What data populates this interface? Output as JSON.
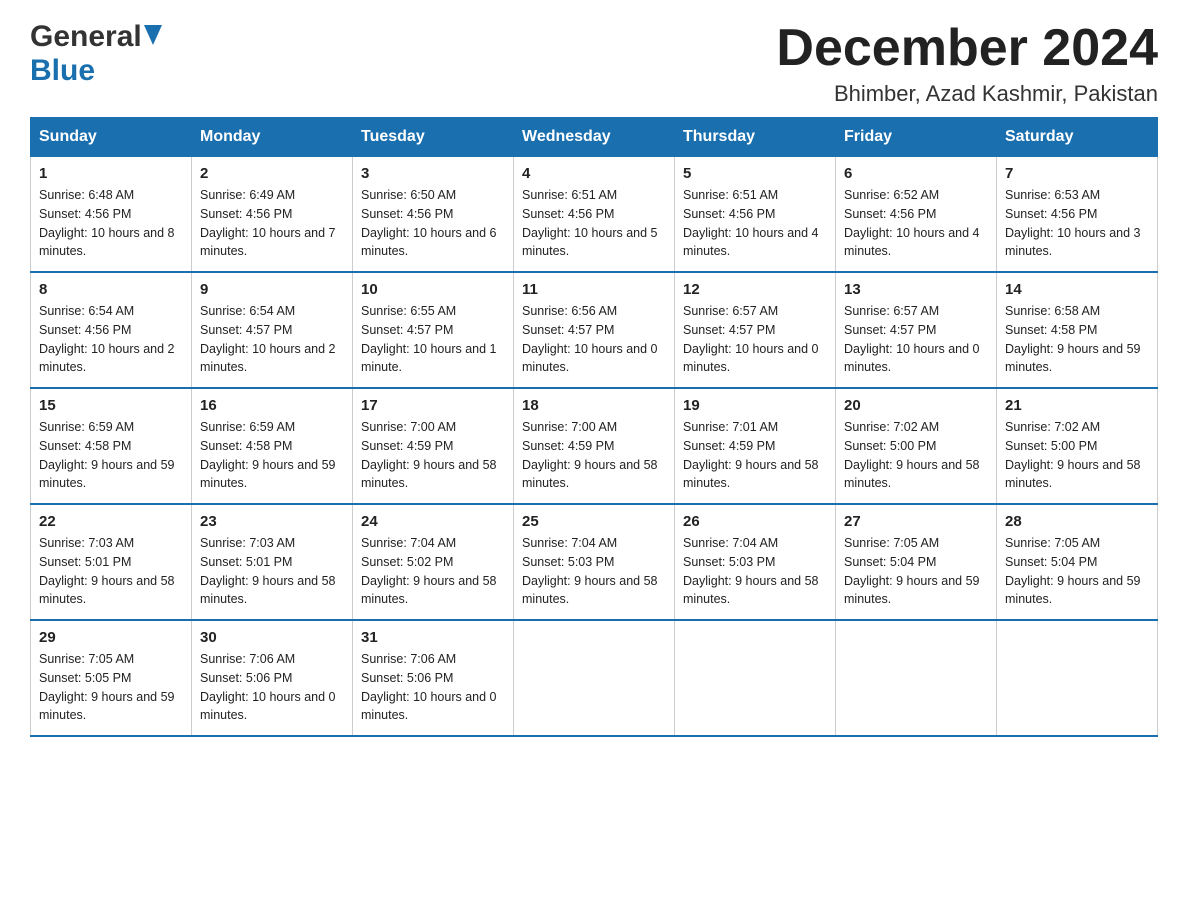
{
  "header": {
    "logo_general": "General",
    "logo_blue": "Blue",
    "month_title": "December 2024",
    "location": "Bhimber, Azad Kashmir, Pakistan"
  },
  "calendar": {
    "days": [
      "Sunday",
      "Monday",
      "Tuesday",
      "Wednesday",
      "Thursday",
      "Friday",
      "Saturday"
    ],
    "weeks": [
      [
        {
          "day": "1",
          "sunrise": "6:48 AM",
          "sunset": "4:56 PM",
          "daylight": "10 hours and 8 minutes."
        },
        {
          "day": "2",
          "sunrise": "6:49 AM",
          "sunset": "4:56 PM",
          "daylight": "10 hours and 7 minutes."
        },
        {
          "day": "3",
          "sunrise": "6:50 AM",
          "sunset": "4:56 PM",
          "daylight": "10 hours and 6 minutes."
        },
        {
          "day": "4",
          "sunrise": "6:51 AM",
          "sunset": "4:56 PM",
          "daylight": "10 hours and 5 minutes."
        },
        {
          "day": "5",
          "sunrise": "6:51 AM",
          "sunset": "4:56 PM",
          "daylight": "10 hours and 4 minutes."
        },
        {
          "day": "6",
          "sunrise": "6:52 AM",
          "sunset": "4:56 PM",
          "daylight": "10 hours and 4 minutes."
        },
        {
          "day": "7",
          "sunrise": "6:53 AM",
          "sunset": "4:56 PM",
          "daylight": "10 hours and 3 minutes."
        }
      ],
      [
        {
          "day": "8",
          "sunrise": "6:54 AM",
          "sunset": "4:56 PM",
          "daylight": "10 hours and 2 minutes."
        },
        {
          "day": "9",
          "sunrise": "6:54 AM",
          "sunset": "4:57 PM",
          "daylight": "10 hours and 2 minutes."
        },
        {
          "day": "10",
          "sunrise": "6:55 AM",
          "sunset": "4:57 PM",
          "daylight": "10 hours and 1 minute."
        },
        {
          "day": "11",
          "sunrise": "6:56 AM",
          "sunset": "4:57 PM",
          "daylight": "10 hours and 0 minutes."
        },
        {
          "day": "12",
          "sunrise": "6:57 AM",
          "sunset": "4:57 PM",
          "daylight": "10 hours and 0 minutes."
        },
        {
          "day": "13",
          "sunrise": "6:57 AM",
          "sunset": "4:57 PM",
          "daylight": "10 hours and 0 minutes."
        },
        {
          "day": "14",
          "sunrise": "6:58 AM",
          "sunset": "4:58 PM",
          "daylight": "9 hours and 59 minutes."
        }
      ],
      [
        {
          "day": "15",
          "sunrise": "6:59 AM",
          "sunset": "4:58 PM",
          "daylight": "9 hours and 59 minutes."
        },
        {
          "day": "16",
          "sunrise": "6:59 AM",
          "sunset": "4:58 PM",
          "daylight": "9 hours and 59 minutes."
        },
        {
          "day": "17",
          "sunrise": "7:00 AM",
          "sunset": "4:59 PM",
          "daylight": "9 hours and 58 minutes."
        },
        {
          "day": "18",
          "sunrise": "7:00 AM",
          "sunset": "4:59 PM",
          "daylight": "9 hours and 58 minutes."
        },
        {
          "day": "19",
          "sunrise": "7:01 AM",
          "sunset": "4:59 PM",
          "daylight": "9 hours and 58 minutes."
        },
        {
          "day": "20",
          "sunrise": "7:02 AM",
          "sunset": "5:00 PM",
          "daylight": "9 hours and 58 minutes."
        },
        {
          "day": "21",
          "sunrise": "7:02 AM",
          "sunset": "5:00 PM",
          "daylight": "9 hours and 58 minutes."
        }
      ],
      [
        {
          "day": "22",
          "sunrise": "7:03 AM",
          "sunset": "5:01 PM",
          "daylight": "9 hours and 58 minutes."
        },
        {
          "day": "23",
          "sunrise": "7:03 AM",
          "sunset": "5:01 PM",
          "daylight": "9 hours and 58 minutes."
        },
        {
          "day": "24",
          "sunrise": "7:04 AM",
          "sunset": "5:02 PM",
          "daylight": "9 hours and 58 minutes."
        },
        {
          "day": "25",
          "sunrise": "7:04 AM",
          "sunset": "5:03 PM",
          "daylight": "9 hours and 58 minutes."
        },
        {
          "day": "26",
          "sunrise": "7:04 AM",
          "sunset": "5:03 PM",
          "daylight": "9 hours and 58 minutes."
        },
        {
          "day": "27",
          "sunrise": "7:05 AM",
          "sunset": "5:04 PM",
          "daylight": "9 hours and 59 minutes."
        },
        {
          "day": "28",
          "sunrise": "7:05 AM",
          "sunset": "5:04 PM",
          "daylight": "9 hours and 59 minutes."
        }
      ],
      [
        {
          "day": "29",
          "sunrise": "7:05 AM",
          "sunset": "5:05 PM",
          "daylight": "9 hours and 59 minutes."
        },
        {
          "day": "30",
          "sunrise": "7:06 AM",
          "sunset": "5:06 PM",
          "daylight": "10 hours and 0 minutes."
        },
        {
          "day": "31",
          "sunrise": "7:06 AM",
          "sunset": "5:06 PM",
          "daylight": "10 hours and 0 minutes."
        },
        null,
        null,
        null,
        null
      ]
    ]
  }
}
